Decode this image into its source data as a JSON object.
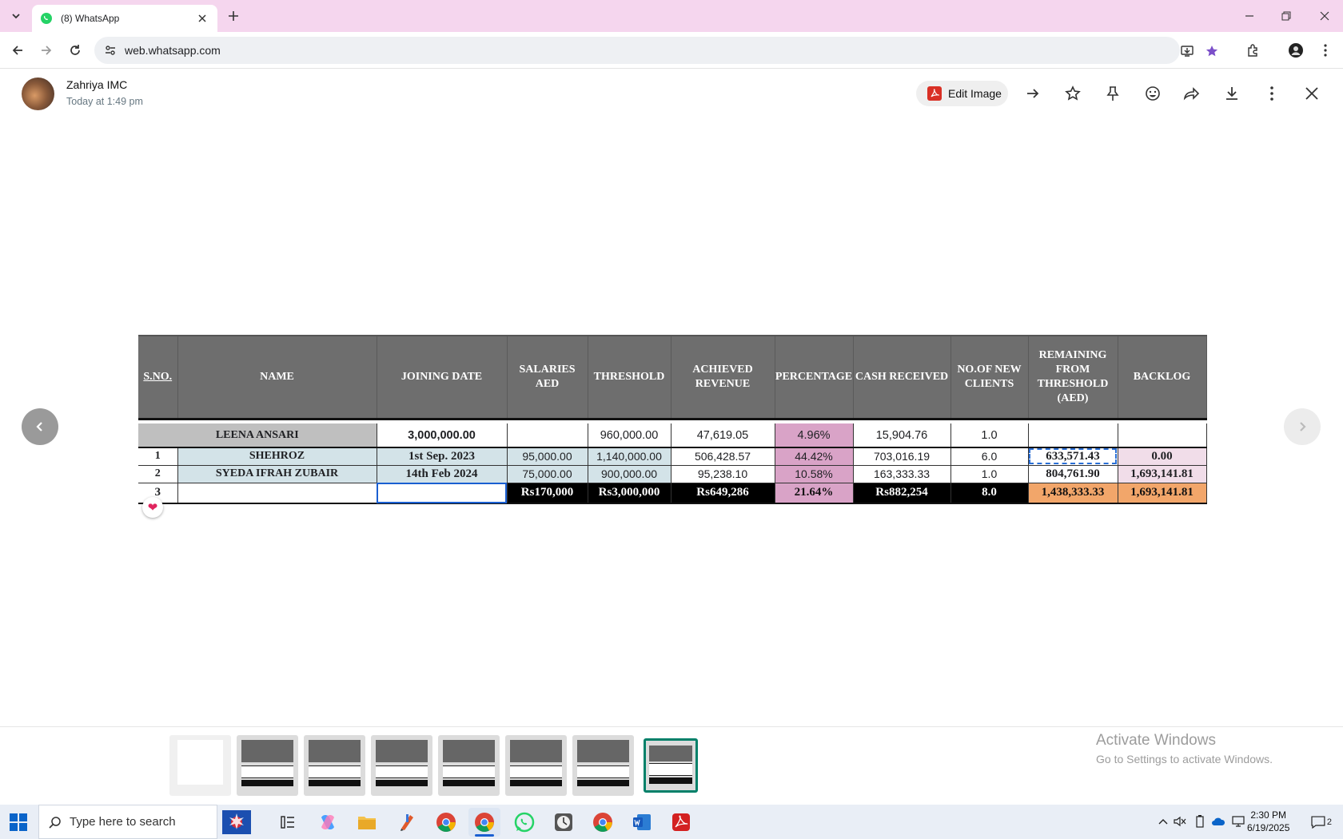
{
  "browser": {
    "tab_title": "(8) WhatsApp",
    "url": "web.whatsapp.com"
  },
  "viewer": {
    "sender": "Zahriya IMC",
    "time": "Today at 1:49 pm",
    "edit_label": "Edit Image"
  },
  "sheet": {
    "headers": {
      "sno": "S.NO.",
      "name": "NAME",
      "joining": "JOINING DATE",
      "salaries": "SALARIES AED",
      "threshold": "THRESHOLD",
      "achieved": "ACHIEVED REVENUE",
      "percentage": "PERCENTAGE",
      "cash": "CASH RECEIVED",
      "clients": "NO.OF NEW CLIENTS",
      "remaining": "REMAINING FROM THRESHOLD (AED)",
      "backlog": "BACKLOG"
    },
    "leena": {
      "name": "LEENA ANSARI",
      "joining": "3,000,000.00",
      "salaries": "",
      "threshold": "960,000.00",
      "achieved": "47,619.05",
      "percentage": "4.96%",
      "cash": "15,904.76",
      "clients": "1.0",
      "remaining": "",
      "backlog": ""
    },
    "rows": [
      {
        "sno": "1",
        "name": "SHEHROZ",
        "joining": "1st Sep. 2023",
        "salaries": "95,000.00",
        "threshold": "1,140,000.00",
        "achieved": "506,428.57",
        "percentage": "44.42%",
        "cash": "703,016.19",
        "clients": "6.0",
        "remaining": "633,571.43",
        "backlog": "0.00"
      },
      {
        "sno": "2",
        "name": "SYEDA IFRAH ZUBAIR",
        "joining": "14th Feb 2024",
        "salaries": "75,000.00",
        "threshold": "900,000.00",
        "achieved": "95,238.10",
        "percentage": "10.58%",
        "cash": "163,333.33",
        "clients": "1.0",
        "remaining": "804,761.90",
        "backlog": "1,693,141.81"
      }
    ],
    "total": {
      "sno": "3",
      "salaries": "Rs170,000",
      "threshold": "Rs3,000,000",
      "achieved": "Rs649,286",
      "percentage": "21.64%",
      "cash": "Rs882,254",
      "clients": "8.0",
      "remaining": "1,438,333.33",
      "backlog": "1,693,141.81"
    },
    "colors": {
      "header_bg": "#6e6e6e",
      "light_blue": "#d3e3e8",
      "pink": "#d9a3c7",
      "orange": "#f2a66a"
    }
  },
  "watermark": {
    "title": "Activate Windows",
    "subtitle": "Go to Settings to activate Windows."
  },
  "taskbar": {
    "search_placeholder": "Type here to search",
    "time": "2:30 PM",
    "date": "6/19/2025",
    "notifications": "2"
  },
  "icons": [
    "chevron-down-icon",
    "whatsapp-icon",
    "close-icon",
    "plus-icon",
    "back-icon",
    "forward-icon",
    "reload-icon",
    "site-info-icon",
    "install-icon",
    "star-icon",
    "extensions-icon",
    "profile-icon",
    "menu-icon",
    "arrow-right-icon",
    "pin-icon",
    "emoji-icon",
    "share-icon",
    "download-icon",
    "heart-icon",
    "windows-icon",
    "search-icon"
  ]
}
